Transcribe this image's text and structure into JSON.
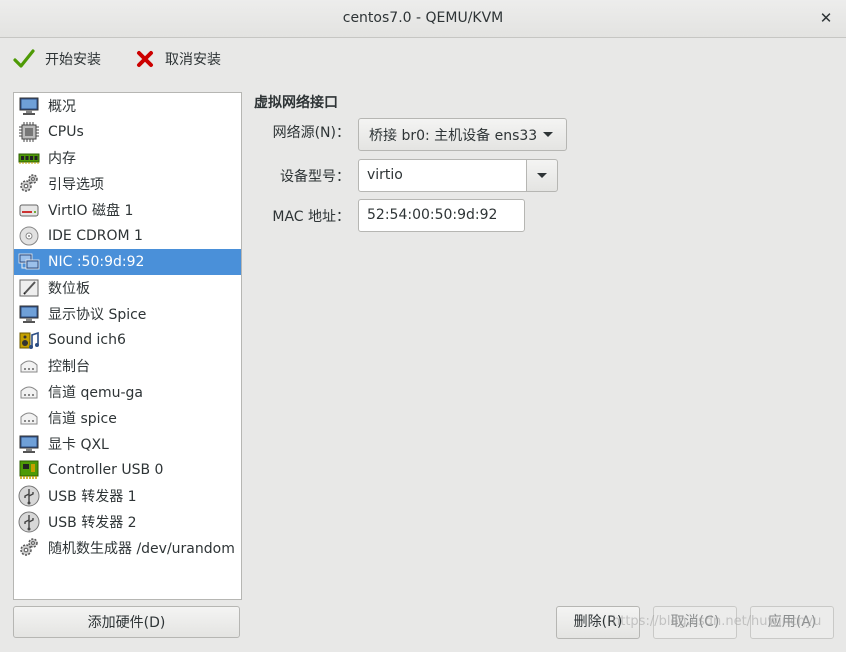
{
  "window": {
    "title": "centos7.0 - QEMU/KVM",
    "close_glyph": "✕"
  },
  "toolbar": {
    "begin_install": {
      "label": "开始安装",
      "icon": "check-icon"
    },
    "cancel_install": {
      "label": "取消安装",
      "icon": "red-x-icon"
    }
  },
  "sidebar": {
    "items": [
      {
        "label": "概况",
        "icon": "monitor-icon"
      },
      {
        "label": "CPUs",
        "icon": "cpu-chip-icon"
      },
      {
        "label": "内存",
        "icon": "memory-stick-icon"
      },
      {
        "label": "引导选项",
        "icon": "gears-icon"
      },
      {
        "label": "VirtIO 磁盘 1",
        "icon": "hard-disk-icon"
      },
      {
        "label": "IDE CDROM 1",
        "icon": "cdrom-icon"
      },
      {
        "label": "NIC :50:9d:92",
        "icon": "network-icon",
        "selected": true
      },
      {
        "label": "数位板",
        "icon": "tablet-icon"
      },
      {
        "label": "显示协议 Spice",
        "icon": "monitor-icon"
      },
      {
        "label": "Sound ich6",
        "icon": "sound-icon"
      },
      {
        "label": "控制台",
        "icon": "serial-port-icon"
      },
      {
        "label": "信道 qemu-ga",
        "icon": "serial-port-icon"
      },
      {
        "label": "信道 spice",
        "icon": "serial-port-icon"
      },
      {
        "label": "显卡 QXL",
        "icon": "monitor-icon"
      },
      {
        "label": "Controller USB 0",
        "icon": "pci-card-icon"
      },
      {
        "label": "USB 转发器 1",
        "icon": "usb-icon"
      },
      {
        "label": "USB 转发器 2",
        "icon": "usb-icon"
      },
      {
        "label": "随机数生成器 /dev/urandom",
        "icon": "gears-icon"
      }
    ],
    "add_hardware_label": "添加硬件(D)"
  },
  "details": {
    "section_title": "虚拟网络接口",
    "network_source": {
      "label": "网络源(N)：",
      "value": "桥接 br0: 主机设备 ens33"
    },
    "device_model": {
      "label": "设备型号：",
      "value": "virtio"
    },
    "mac_address": {
      "label": "MAC 地址：",
      "value": "52:54:00:50:9d:92"
    }
  },
  "buttons": {
    "remove": "删除(R)",
    "cancel": "取消(C)",
    "apply": "应用(A)"
  },
  "watermark": "https://blog.csdn.net/huwinchyu",
  "colors": {
    "selection": "#4a90d9",
    "window_bg": "#e8e8e7"
  }
}
